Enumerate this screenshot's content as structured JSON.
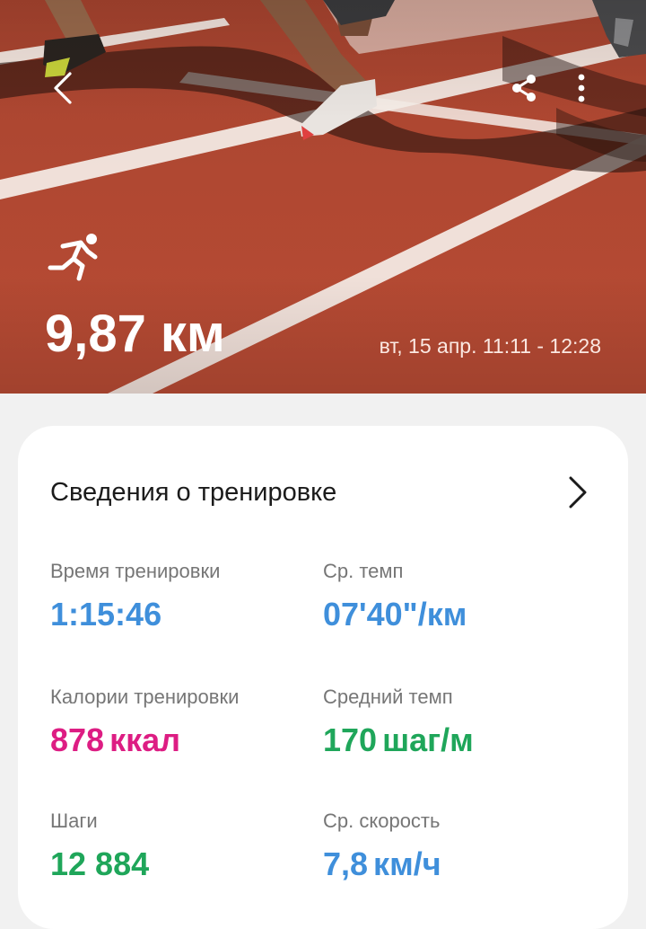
{
  "header": {
    "distance_value": "9,87",
    "distance_unit": "км",
    "datetime": "вт, 15 апр. 11:11 - 12:28",
    "activity_icon": "running-icon",
    "back_icon": "chevron-left-icon",
    "share_icon": "share-icon",
    "more_icon": "more-vertical-icon"
  },
  "card": {
    "title": "Сведения о тренировке",
    "chevron_icon": "chevron-right-icon",
    "stats": [
      {
        "label": "Время тренировки",
        "value": "1:15:46",
        "unit": "",
        "color": "#3f8fdb"
      },
      {
        "label": "Ср. темп",
        "value": "07'40\"",
        "unit": "/км",
        "color": "#3f8fdb"
      },
      {
        "label": "Калории тренировки",
        "value": "878",
        "unit": "ккал",
        "color": "#dd1d83"
      },
      {
        "label": "Средний темп",
        "value": "170",
        "unit": "шаг/м",
        "color": "#1fa65a"
      },
      {
        "label": "Шаги",
        "value": "12 884",
        "unit": "",
        "color": "#1fa65a"
      },
      {
        "label": "Ср. скорость",
        "value": "7,8",
        "unit": "км/ч",
        "color": "#3f8fdb"
      }
    ]
  },
  "colors": {
    "track": "#b04832",
    "lane_line": "#f4ece6",
    "card_bg": "#ffffff",
    "page_bg": "#f1f1f1"
  }
}
